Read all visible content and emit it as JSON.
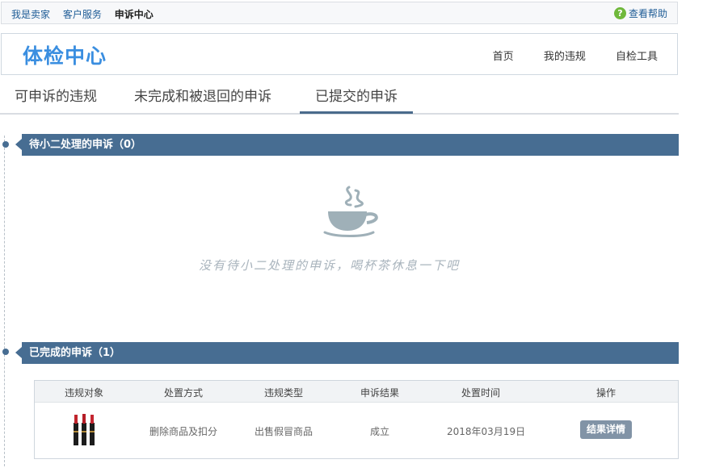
{
  "topbar": {
    "links": [
      "我是卖家",
      "客户服务"
    ],
    "current": "申诉中心",
    "help_icon": "question-circle-icon",
    "help_label": "查看帮助"
  },
  "header": {
    "title": "体检中心",
    "nav": [
      "首页",
      "我的违规",
      "自检工具"
    ]
  },
  "tabs": [
    {
      "label": "可申诉的违规",
      "active": false
    },
    {
      "label": "未完成和被退回的申诉",
      "active": false
    },
    {
      "label": "已提交的申诉",
      "active": true
    }
  ],
  "pending": {
    "title": "待小二处理的申诉（0）",
    "empty_icon": "tea-cup-icon",
    "empty_message": "没有待小二处理的申诉，喝杯茶休息一下吧"
  },
  "completed": {
    "title": "已完成的申诉（1）",
    "columns": [
      "违规对象",
      "处置方式",
      "违规类型",
      "申诉结果",
      "处置时间",
      "操作"
    ],
    "rows": [
      {
        "product_image": "lipstick-product-image",
        "action": "删除商品及扣分",
        "type": "出售假冒商品",
        "result": "成立",
        "time": "2018年03月19日",
        "button": "结果详情"
      }
    ]
  },
  "colors": {
    "accent": "#476d92",
    "title_blue": "#3a8ee0",
    "link_blue": "#1e5c96",
    "button_gray": "#8193a6"
  }
}
